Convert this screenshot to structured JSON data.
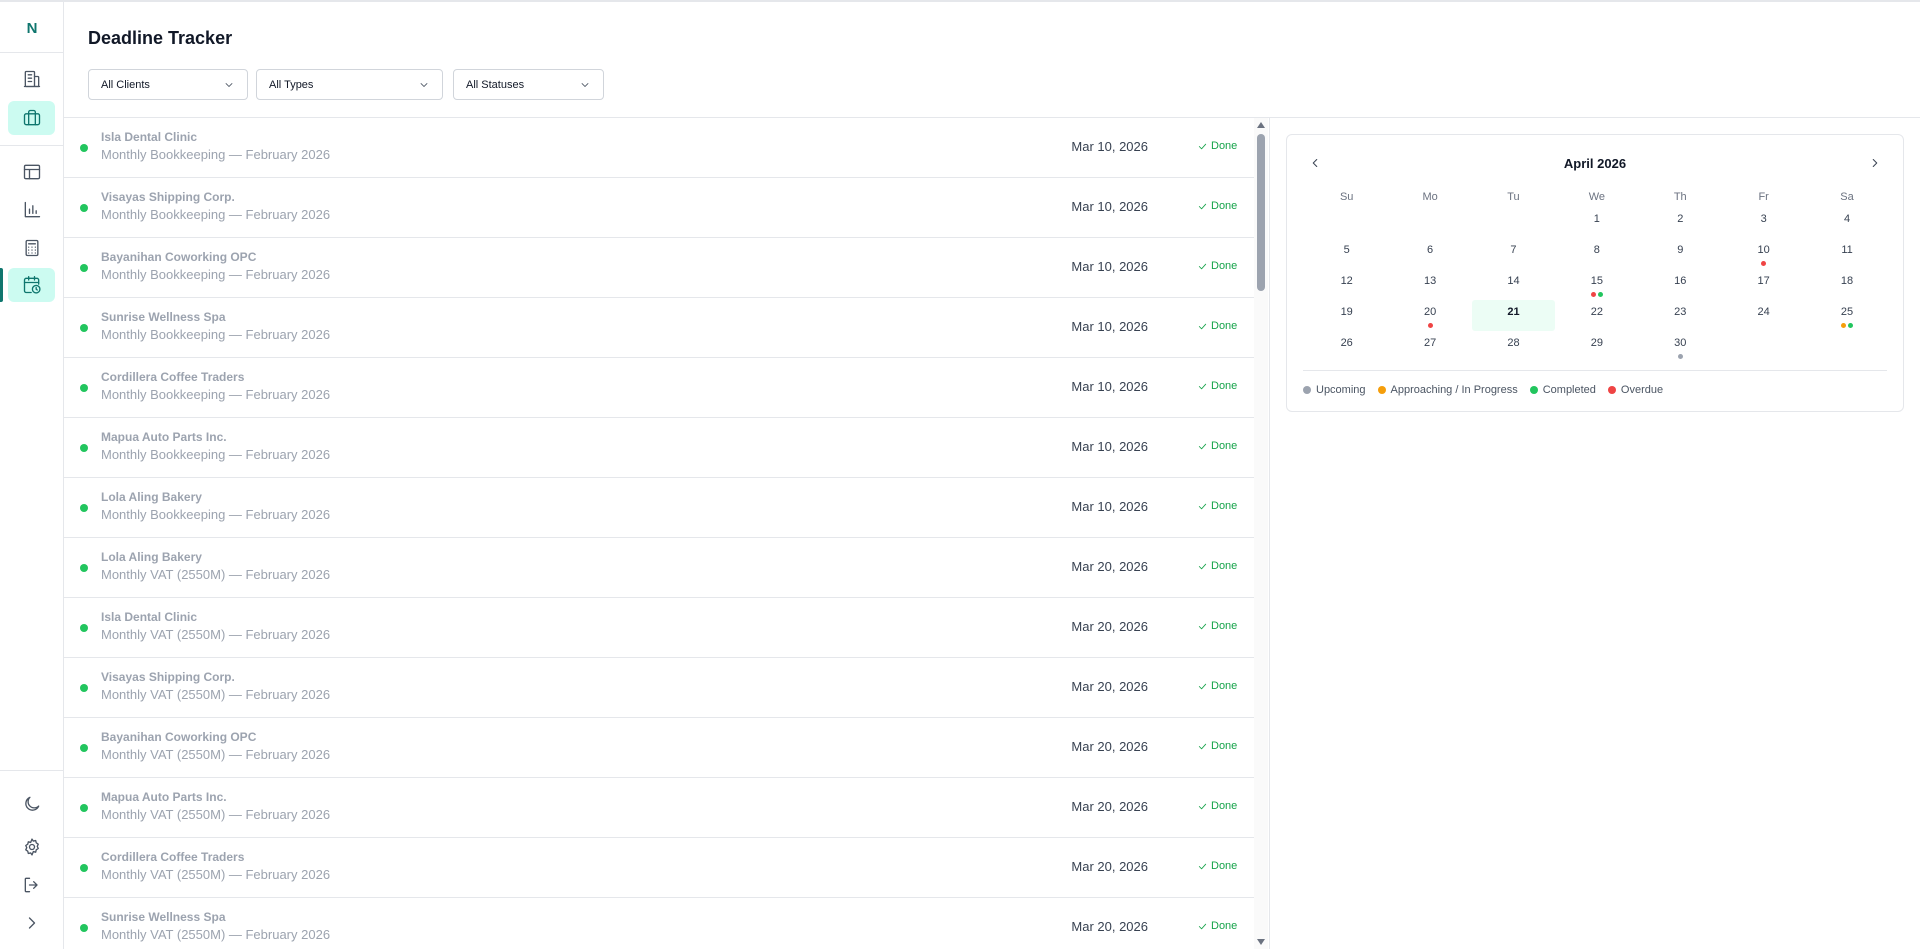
{
  "colors": {
    "accent": "#0f766e",
    "upcoming": "#9ca3af",
    "approaching": "#f59e0b",
    "completed": "#22c55e",
    "overdue": "#ef4444"
  },
  "sidebar": {
    "logo": "N",
    "items": [
      {
        "name": "building-icon"
      },
      {
        "name": "briefcase-icon"
      },
      {
        "name": "table-icon"
      },
      {
        "name": "bar-chart-icon"
      },
      {
        "name": "calculator-icon"
      },
      {
        "name": "calendar-clock-icon"
      }
    ],
    "bottom": [
      {
        "name": "moon-icon"
      },
      {
        "name": "gear-icon"
      },
      {
        "name": "logout-icon"
      },
      {
        "name": "chevron-right-icon"
      }
    ]
  },
  "header": {
    "title": "Deadline Tracker",
    "filters": {
      "clients": "All Clients",
      "types": "All Types",
      "statuses": "All Statuses"
    }
  },
  "deadlines": [
    {
      "client": "Isla Dental Clinic",
      "task": "Monthly Bookkeeping — February 2026",
      "date": "Mar 10, 2026",
      "status": "Done"
    },
    {
      "client": "Visayas Shipping Corp.",
      "task": "Monthly Bookkeeping — February 2026",
      "date": "Mar 10, 2026",
      "status": "Done"
    },
    {
      "client": "Bayanihan Coworking OPC",
      "task": "Monthly Bookkeeping — February 2026",
      "date": "Mar 10, 2026",
      "status": "Done"
    },
    {
      "client": "Sunrise Wellness Spa",
      "task": "Monthly Bookkeeping — February 2026",
      "date": "Mar 10, 2026",
      "status": "Done"
    },
    {
      "client": "Cordillera Coffee Traders",
      "task": "Monthly Bookkeeping — February 2026",
      "date": "Mar 10, 2026",
      "status": "Done"
    },
    {
      "client": "Mapua Auto Parts Inc.",
      "task": "Monthly Bookkeeping — February 2026",
      "date": "Mar 10, 2026",
      "status": "Done"
    },
    {
      "client": "Lola Aling Bakery",
      "task": "Monthly Bookkeeping — February 2026",
      "date": "Mar 10, 2026",
      "status": "Done"
    },
    {
      "client": "Lola Aling Bakery",
      "task": "Monthly VAT (2550M) — February 2026",
      "date": "Mar 20, 2026",
      "status": "Done"
    },
    {
      "client": "Isla Dental Clinic",
      "task": "Monthly VAT (2550M) — February 2026",
      "date": "Mar 20, 2026",
      "status": "Done"
    },
    {
      "client": "Visayas Shipping Corp.",
      "task": "Monthly VAT (2550M) — February 2026",
      "date": "Mar 20, 2026",
      "status": "Done"
    },
    {
      "client": "Bayanihan Coworking OPC",
      "task": "Monthly VAT (2550M) — February 2026",
      "date": "Mar 20, 2026",
      "status": "Done"
    },
    {
      "client": "Mapua Auto Parts Inc.",
      "task": "Monthly VAT (2550M) — February 2026",
      "date": "Mar 20, 2026",
      "status": "Done"
    },
    {
      "client": "Cordillera Coffee Traders",
      "task": "Monthly VAT (2550M) — February 2026",
      "date": "Mar 20, 2026",
      "status": "Done"
    },
    {
      "client": "Sunrise Wellness Spa",
      "task": "Monthly VAT (2550M) — February 2026",
      "date": "Mar 20, 2026",
      "status": "Done"
    }
  ],
  "calendar": {
    "month": "April 2026",
    "weekdays": [
      "Su",
      "Mo",
      "Tu",
      "We",
      "Th",
      "Fr",
      "Sa"
    ],
    "today": "21",
    "weeks": [
      [
        {
          "d": ""
        },
        {
          "d": ""
        },
        {
          "d": ""
        },
        {
          "d": "1"
        },
        {
          "d": "2"
        },
        {
          "d": "3"
        },
        {
          "d": "4"
        }
      ],
      [
        {
          "d": "5"
        },
        {
          "d": "6"
        },
        {
          "d": "7"
        },
        {
          "d": "8"
        },
        {
          "d": "9"
        },
        {
          "d": "10",
          "dots": [
            "overdue"
          ]
        },
        {
          "d": "11"
        }
      ],
      [
        {
          "d": "12"
        },
        {
          "d": "13"
        },
        {
          "d": "14"
        },
        {
          "d": "15",
          "dots": [
            "overdue",
            "completed"
          ]
        },
        {
          "d": "16"
        },
        {
          "d": "17"
        },
        {
          "d": "18"
        }
      ],
      [
        {
          "d": "19"
        },
        {
          "d": "20",
          "dots": [
            "overdue"
          ]
        },
        {
          "d": "21"
        },
        {
          "d": "22"
        },
        {
          "d": "23"
        },
        {
          "d": "24"
        },
        {
          "d": "25",
          "dots": [
            "approaching",
            "completed"
          ]
        }
      ],
      [
        {
          "d": "26"
        },
        {
          "d": "27"
        },
        {
          "d": "28"
        },
        {
          "d": "29"
        },
        {
          "d": "30",
          "dots": [
            "upcoming"
          ]
        },
        {
          "d": ""
        },
        {
          "d": ""
        }
      ]
    ],
    "legend": [
      {
        "label": "Upcoming",
        "key": "upcoming"
      },
      {
        "label": "Approaching / In Progress",
        "key": "approaching"
      },
      {
        "label": "Completed",
        "key": "completed"
      },
      {
        "label": "Overdue",
        "key": "overdue"
      }
    ]
  }
}
